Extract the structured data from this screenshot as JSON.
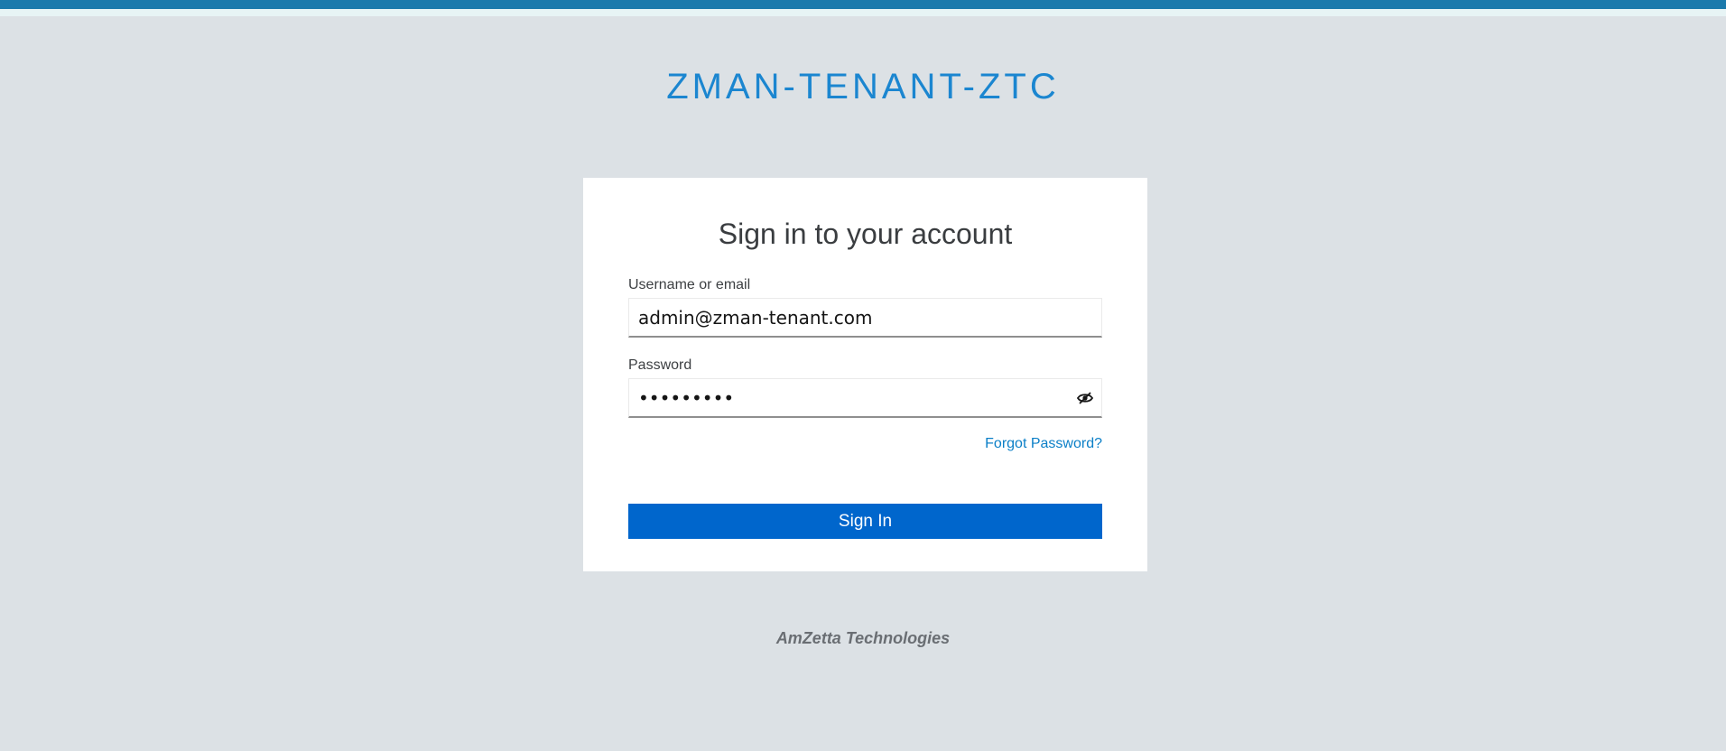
{
  "realm": {
    "title": "ZMAN-TENANT-ZTC"
  },
  "login_card": {
    "title": "Sign in to your account",
    "username": {
      "label": "Username or email",
      "value": "admin@zman-tenant.com"
    },
    "password": {
      "label": "Password",
      "value": "•••••••••",
      "toggle_icon": "eye-slash-icon"
    },
    "forgot_password_label": "Forgot Password?",
    "sign_in_label": "Sign In"
  },
  "footer": {
    "brand": "AmZetta Technologies"
  },
  "colors": {
    "top_bar": "#1b7aac",
    "realm_title": "#1b86d0",
    "primary_button": "#0066cc",
    "link": "#0b7fc7",
    "background": "#dce1e5"
  }
}
